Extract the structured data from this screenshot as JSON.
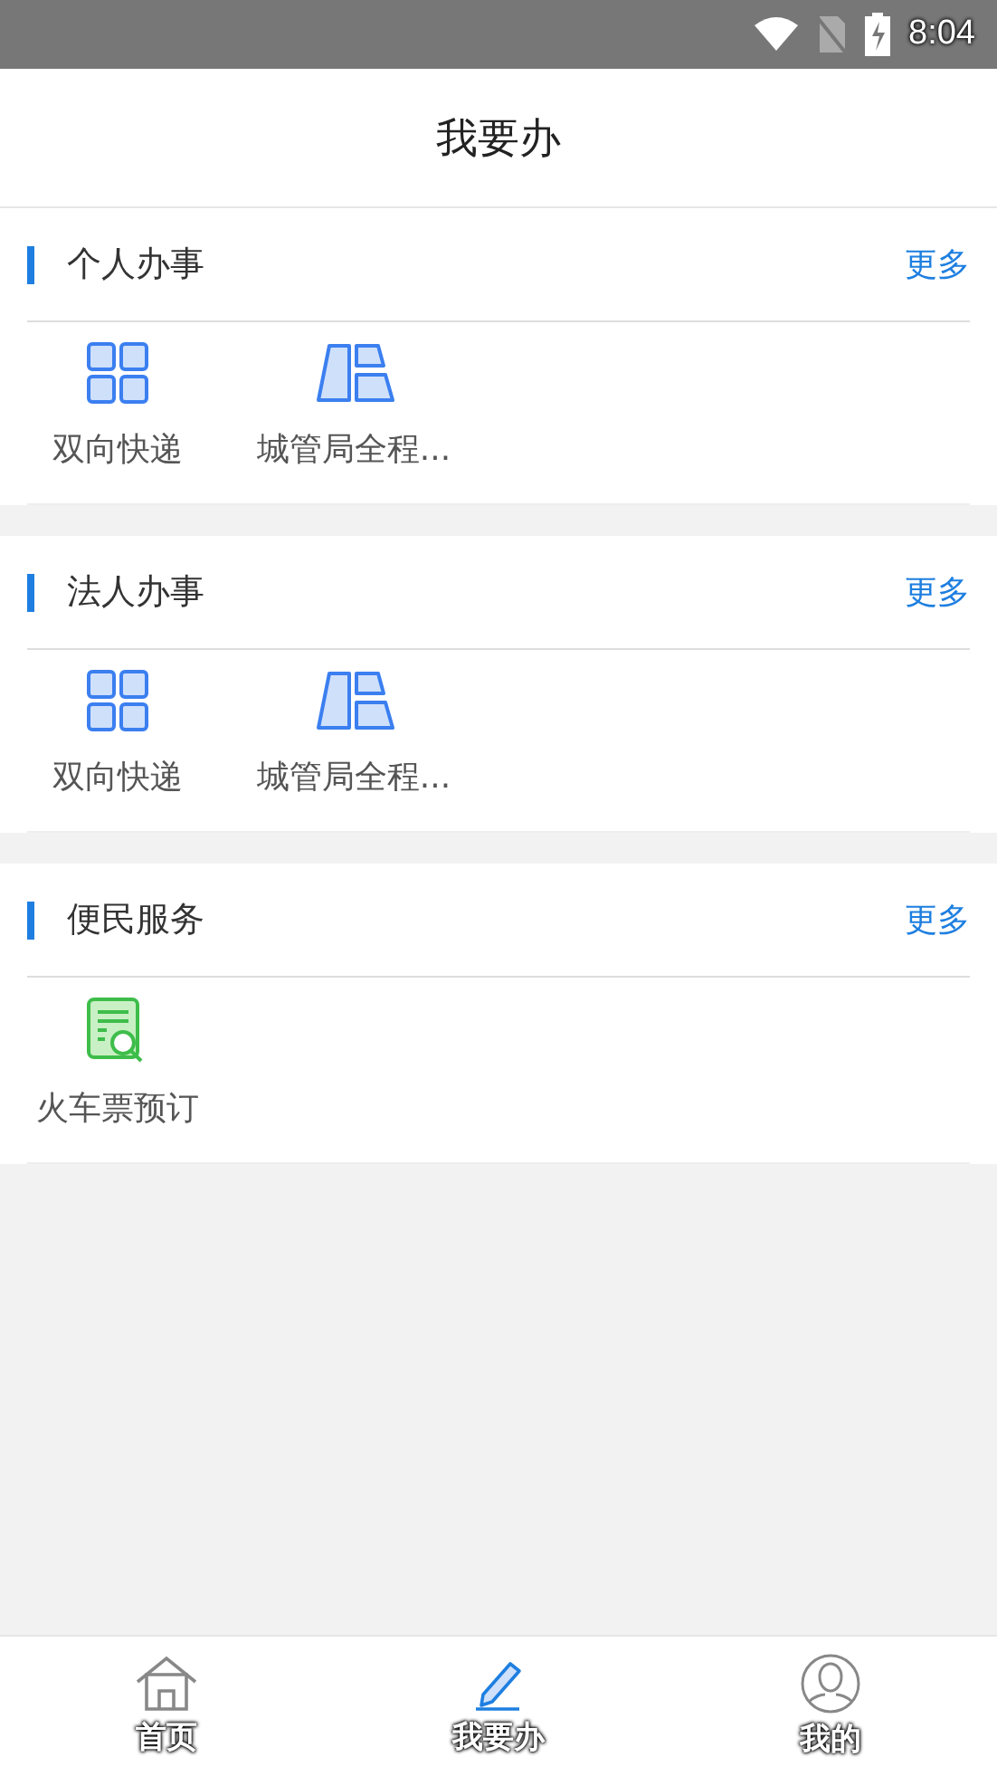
{
  "status_bar": {
    "time": "8:04"
  },
  "header": {
    "title": "我要办"
  },
  "sections": [
    {
      "title": "个人办事",
      "more": "更多",
      "items": [
        {
          "kind": "grid",
          "label": "双向快递"
        },
        {
          "kind": "panels",
          "label": "城管局全程..."
        }
      ]
    },
    {
      "title": "法人办事",
      "more": "更多",
      "items": [
        {
          "kind": "grid",
          "label": "双向快递"
        },
        {
          "kind": "panels",
          "label": "城管局全程..."
        }
      ]
    },
    {
      "title": "便民服务",
      "more": "更多",
      "items": [
        {
          "kind": "doc",
          "label": "火车票预订"
        }
      ]
    }
  ],
  "tabs": [
    {
      "kind": "home",
      "label": "首页",
      "selected": false
    },
    {
      "kind": "pencil",
      "label": "我要办",
      "selected": true
    },
    {
      "kind": "user",
      "label": "我的",
      "selected": false
    }
  ]
}
